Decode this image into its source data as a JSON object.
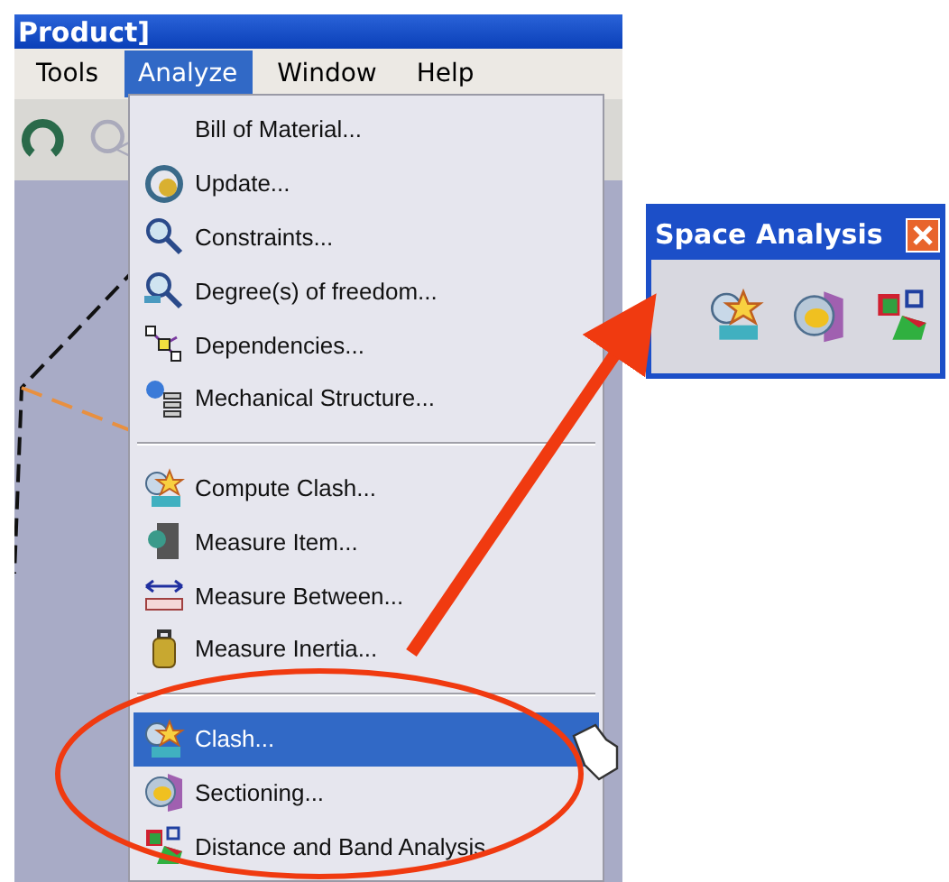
{
  "window": {
    "title": "Product]"
  },
  "menubar": [
    {
      "label": "Tools",
      "selected": false
    },
    {
      "label": "Analyze",
      "selected": true
    },
    {
      "label": "Window",
      "selected": false
    },
    {
      "label": "Help",
      "selected": false
    }
  ],
  "menu": [
    {
      "kind": "item",
      "label": "Bill of Material...",
      "icon": false,
      "selected": false
    },
    {
      "kind": "item",
      "label": "Update...",
      "icon": true,
      "selected": false
    },
    {
      "kind": "item",
      "label": "Constraints...",
      "icon": true,
      "selected": false
    },
    {
      "kind": "item",
      "label": "Degree(s) of freedom...",
      "icon": true,
      "selected": false
    },
    {
      "kind": "item",
      "label": "Dependencies...",
      "icon": true,
      "selected": false
    },
    {
      "kind": "item",
      "label": "Mechanical Structure...",
      "icon": true,
      "selected": false
    },
    {
      "kind": "separator"
    },
    {
      "kind": "item",
      "label": "Compute Clash...",
      "icon": true,
      "selected": false
    },
    {
      "kind": "item",
      "label": "Measure Item...",
      "icon": true,
      "selected": false
    },
    {
      "kind": "item",
      "label": "Measure Between...",
      "icon": true,
      "selected": false
    },
    {
      "kind": "item",
      "label": "Measure Inertia...",
      "icon": true,
      "selected": false
    },
    {
      "kind": "separator"
    },
    {
      "kind": "item",
      "label": "Clash...",
      "icon": true,
      "selected": true
    },
    {
      "kind": "item",
      "label": "Sectioning...",
      "icon": true,
      "selected": false
    },
    {
      "kind": "item",
      "label": "Distance and Band Analysis",
      "icon": true,
      "selected": false
    }
  ],
  "toolbar": {
    "title": "Space Analysis"
  }
}
